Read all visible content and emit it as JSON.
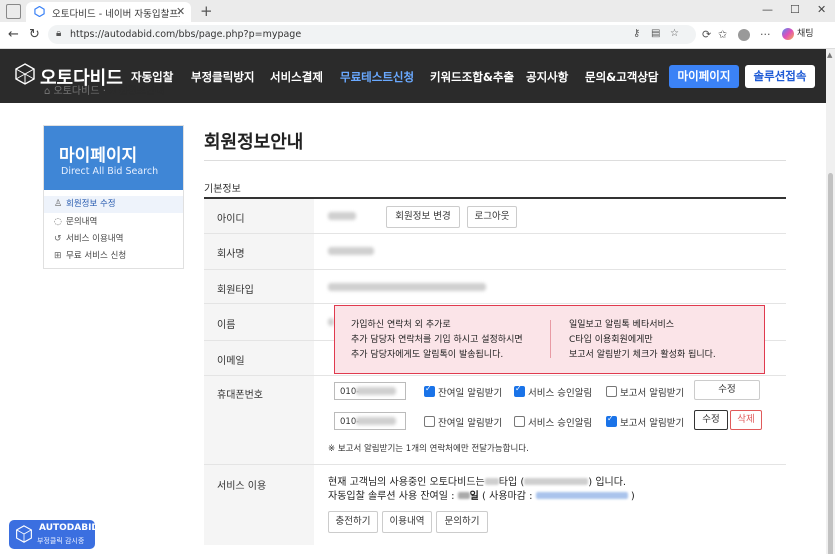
{
  "browser": {
    "tab_title": "오토다비드 - 네이버 자동입찰프로",
    "url": "https://autodabid.com/bbs/page.php?p=mypage",
    "chat_label": "채팅"
  },
  "site": {
    "logo": "오토다비드",
    "menu": [
      "자동입찰",
      "부정클릭방지",
      "서비스결제",
      "무료테스트신청",
      "키워드조합&추출",
      "공지사항",
      "문의&고객상담"
    ],
    "btn_mypage": "마이페이지",
    "btn_solution": "솔루션접속",
    "breadcrumb_prev": "오토다비드 · ",
    "breadcrumb_cur": "회원정보안내"
  },
  "sidebar": {
    "title": "마이페이지",
    "subtitle": "Direct All Bid Search",
    "items": [
      {
        "icon": "user-icon",
        "label": "회원정보 수정"
      },
      {
        "icon": "chat-icon",
        "label": "문의내역"
      },
      {
        "icon": "history-icon",
        "label": "서비스 이용내역"
      },
      {
        "icon": "gift-icon",
        "label": "무료 서비스 신청"
      }
    ]
  },
  "content": {
    "title": "회원정보안내",
    "section": "기본정보",
    "labels": {
      "id": "아이디",
      "company": "회사명",
      "member_type": "회원타입",
      "name": "이름",
      "email": "이메일",
      "phone": "휴대폰번호",
      "service": "서비스 이용"
    },
    "btn_edit_info": "회원정보 변경",
    "btn_logout": "로그아웃",
    "phones": [
      {
        "value": "010-",
        "alerts": [
          true,
          true,
          false
        ],
        "btn_edit": "수정"
      },
      {
        "value": "010-",
        "alerts": [
          false,
          false,
          true
        ],
        "btn_edit": "수정",
        "btn_delete": "삭제"
      }
    ],
    "alert_labels": [
      "잔여일 알림받기",
      "서비스 승인알림",
      "보고서 알림받기"
    ],
    "phone_note": "※ 보고서 알림받기는 1개의 연락처에만 전달가능합니다.",
    "service_line1_a": "현재 고객님의 사용중인 오토다비드는",
    "service_line1_b": "타입 (",
    "service_line1_c": ") 입니다.",
    "service_line2_a": "자동입찰 솔루션 사용 잔여일 : ",
    "service_line2_b": "일",
    "service_line2_c": " ( 사용마감 : ",
    "service_line2_d": " )",
    "btn_charge": "충전하기",
    "btn_history": "이용내역",
    "btn_inquiry": "문의하기"
  },
  "popup": {
    "left": [
      "가입하신 연락처 외 추가로",
      "추가 담당자 연락처를 기입 하시고 설정하시면",
      "추가 담당자에게도 알림톡이 발송됩니다."
    ],
    "right": [
      "일일보고 알림톡 베타서비스",
      "C타입 이용회원에게만",
      "보고서 알림받기 체크가 활성화 됩니다."
    ]
  },
  "fab": {
    "title": "AUTODABID",
    "subtitle": "부정클릭 감시중"
  },
  "colors": {
    "header_bg": "#2b2b2b",
    "accent": "#3b82f6",
    "active_menu": "#6aa9ff",
    "popup_border": "#e03a4e",
    "popup_bg": "#fbe4e8"
  }
}
